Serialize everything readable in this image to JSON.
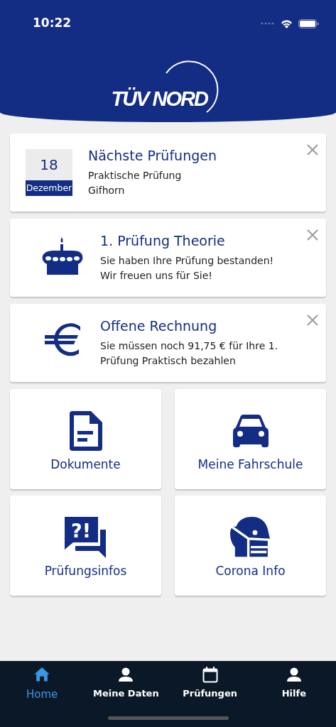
{
  "status_bar": {
    "time": "10:22"
  },
  "header": {
    "logo": "TÜV NORD"
  },
  "notices": [
    {
      "kind": "date",
      "day": "18",
      "month": "Dezember",
      "title": "Nächste Prüfungen",
      "lines": [
        "Praktische Prüfung",
        "Gifhorn"
      ]
    },
    {
      "kind": "cake",
      "title": "1. Prüfung Theorie",
      "lines": [
        "Sie haben Ihre Prüfung bestanden!",
        "Wir freuen uns für Sie!"
      ]
    },
    {
      "kind": "euro",
      "title": "Offene Rechnung",
      "lines": [
        "Sie müssen noch 91,75 € für Ihre 1.",
        "Prüfung Praktisch bezahlen"
      ]
    }
  ],
  "tiles": [
    {
      "kind": "document",
      "label": "Dokumente"
    },
    {
      "kind": "car",
      "label": "Meine Fahrschule"
    },
    {
      "kind": "questions",
      "glyph": "?!",
      "label": "Prüfungsinfos"
    },
    {
      "kind": "mask",
      "label": "Corona Info"
    }
  ],
  "tab_bar": [
    {
      "kind": "home",
      "label": "Home",
      "selected": true
    },
    {
      "kind": "person",
      "label": "Meine Daten",
      "selected": false
    },
    {
      "kind": "calendar",
      "label": "Prüfungen",
      "selected": false
    },
    {
      "kind": "person",
      "label": "Hilfe",
      "selected": false
    }
  ]
}
